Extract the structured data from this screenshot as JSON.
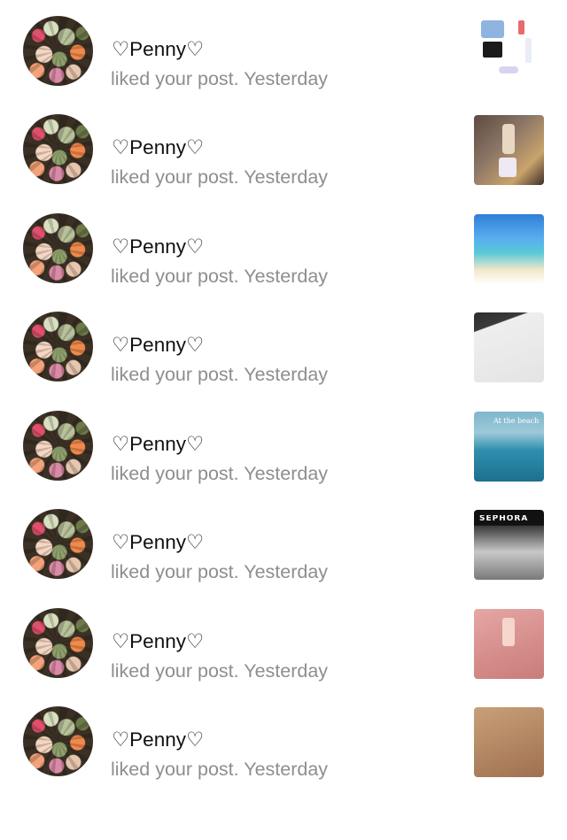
{
  "notifications": [
    {
      "username": "♡Penny♡",
      "action": "liked your post.",
      "time": "Yesterday",
      "thumbnail": "outfit-flatlay",
      "thumb_caption": ""
    },
    {
      "username": "♡Penny♡",
      "action": "liked your post.",
      "time": "Yesterday",
      "thumbnail": "bathroom-products",
      "thumb_caption": ""
    },
    {
      "username": "♡Penny♡",
      "action": "liked your post.",
      "time": "Yesterday",
      "thumbnail": "beach-summer",
      "thumb_caption": ""
    },
    {
      "username": "♡Penny♡",
      "action": "liked your post.",
      "time": "Yesterday",
      "thumbnail": "white-paper",
      "thumb_caption": ""
    },
    {
      "username": "♡Penny♡",
      "action": "liked your post.",
      "time": "Yesterday",
      "thumbnail": "sea-water",
      "thumb_caption": "At the beach"
    },
    {
      "username": "♡Penny♡",
      "action": "liked your post.",
      "time": "Yesterday",
      "thumbnail": "sephora-store",
      "thumb_caption": "SEPHORA"
    },
    {
      "username": "♡Penny♡",
      "action": "liked your post.",
      "time": "Yesterday",
      "thumbnail": "pink-skincare",
      "thumb_caption": ""
    },
    {
      "username": "♡Penny♡",
      "action": "liked your post.",
      "time": "Yesterday",
      "thumbnail": "glowy-skin",
      "thumb_caption": ""
    }
  ]
}
